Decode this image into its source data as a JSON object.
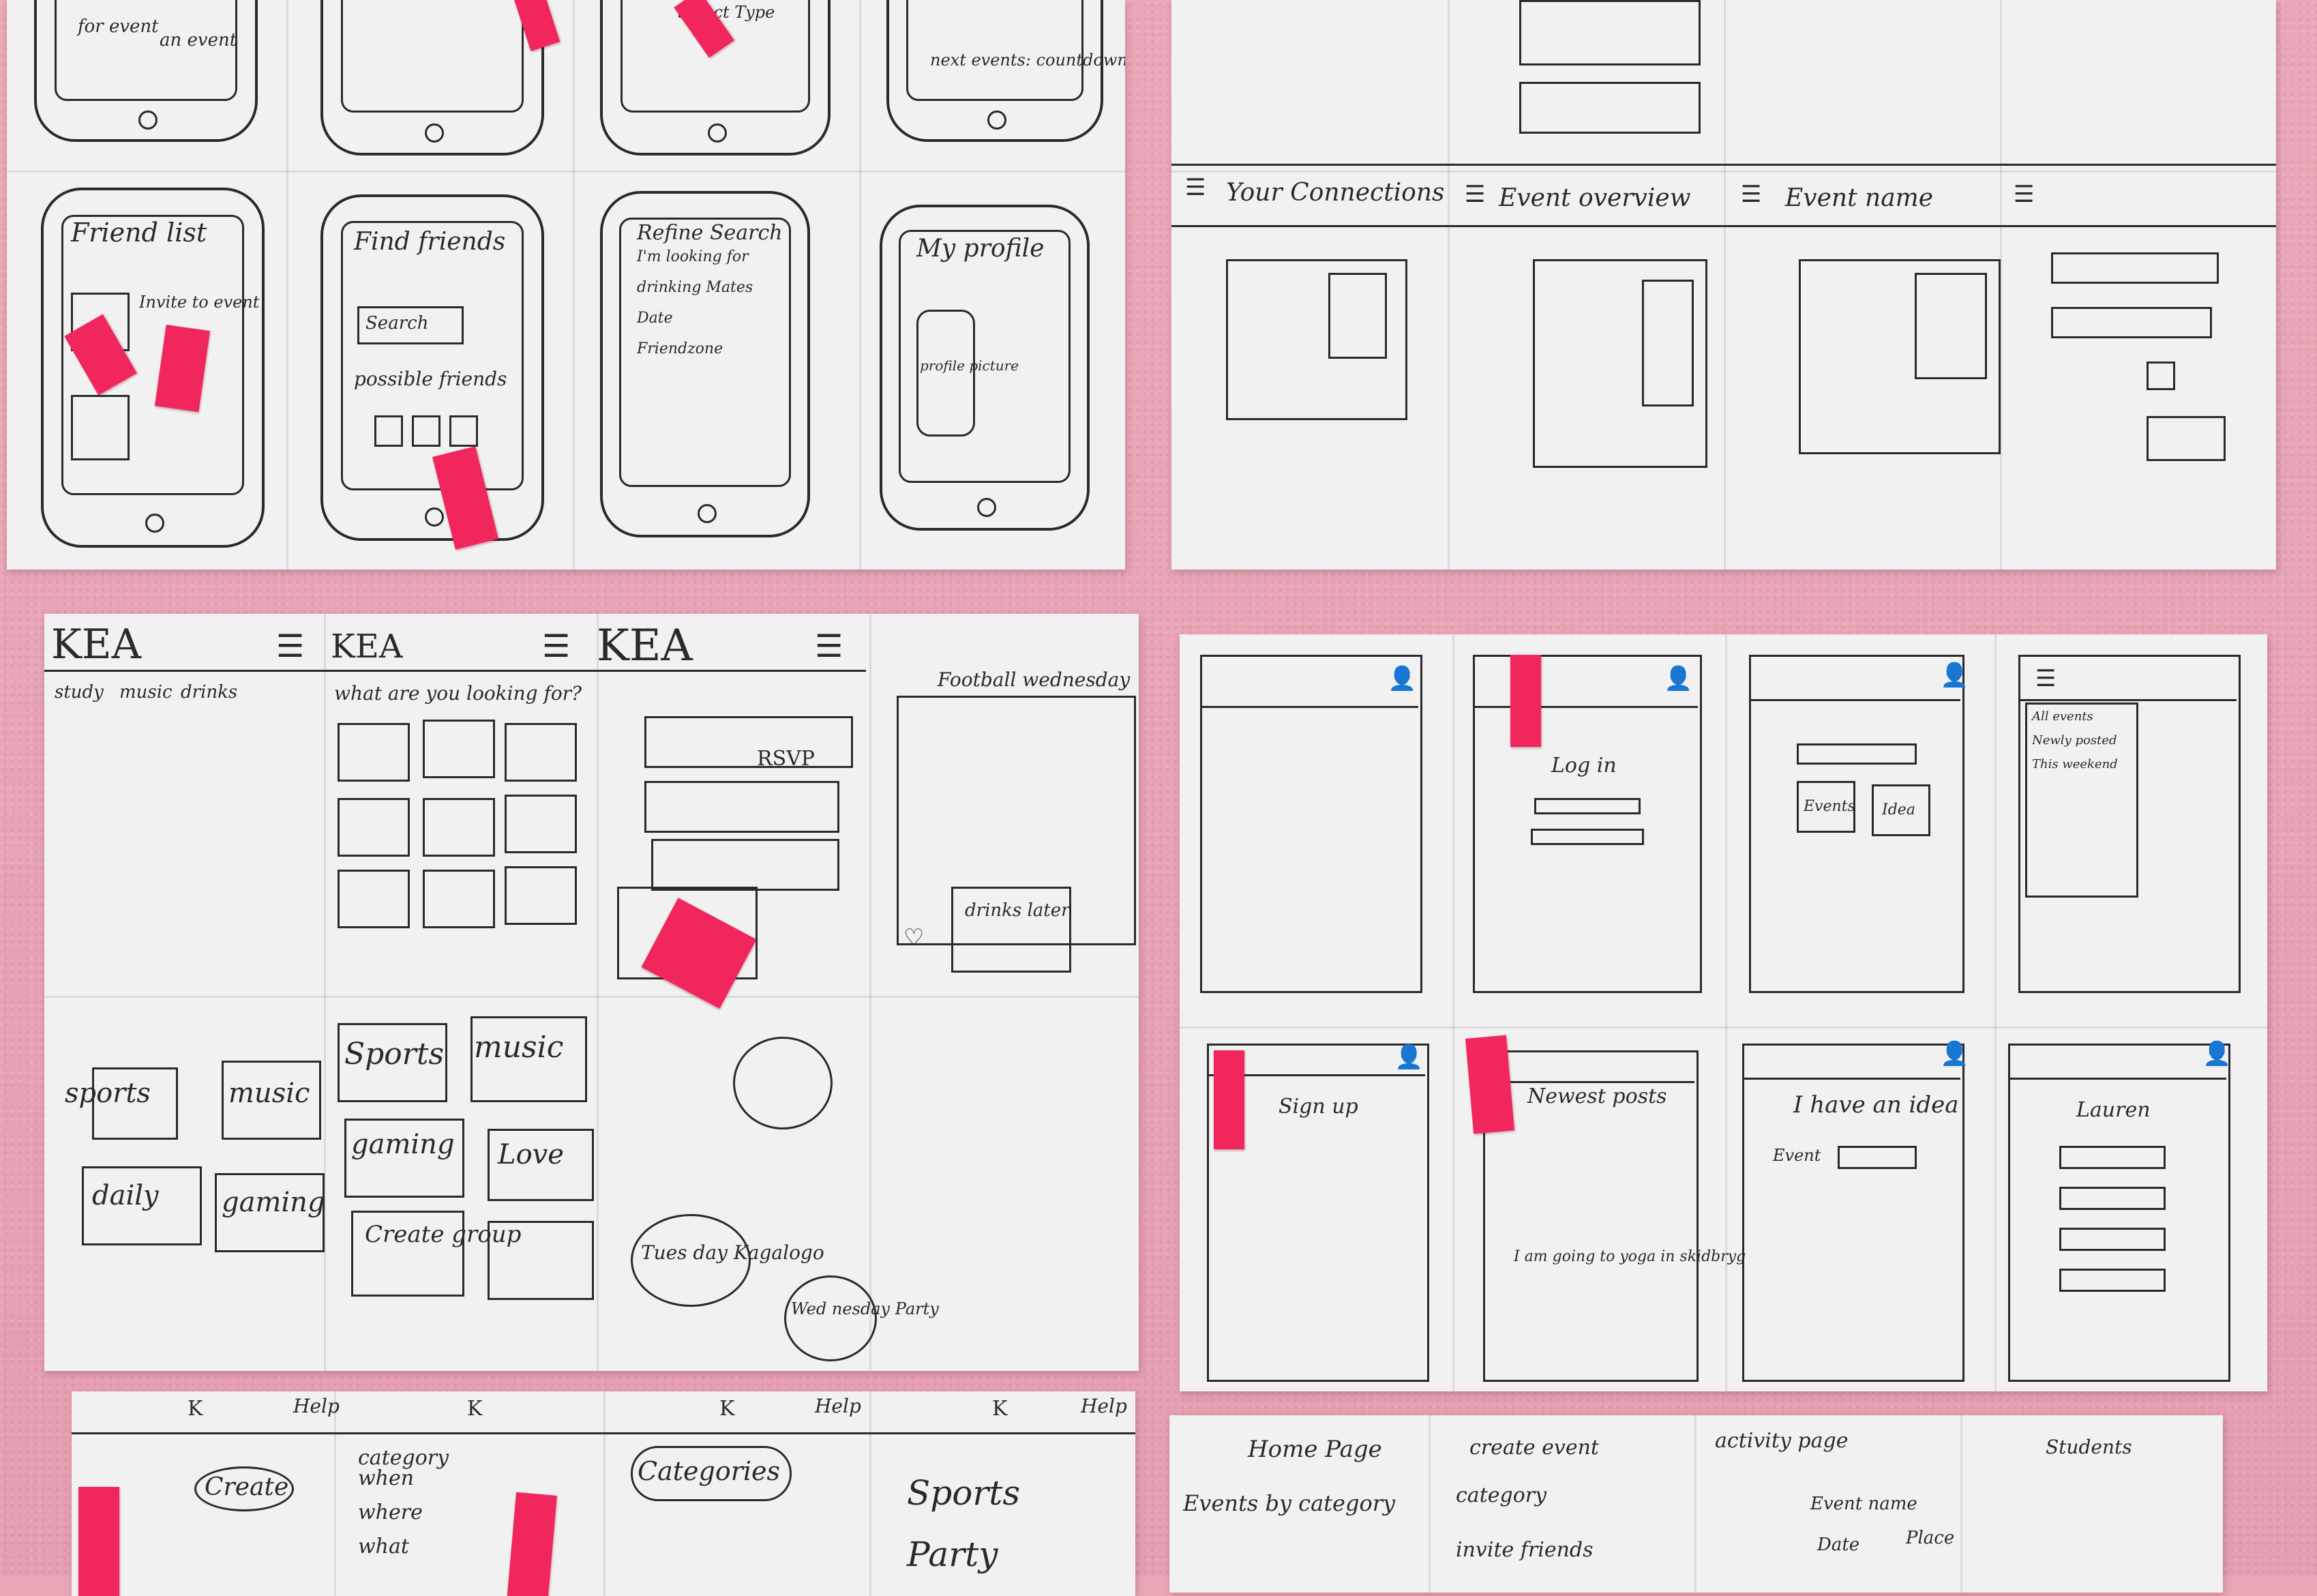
{
  "colors": {
    "wall": "#e9a7b6",
    "paper": "#f1f1f2",
    "ink": "#2a2a2e",
    "sticky_note": "#f0265c"
  },
  "sheet_a": {
    "top_row": [
      "for event",
      "an event",
      "Select Type",
      "next events: countdown"
    ],
    "friend_list": {
      "title": "Friend list",
      "action": "Invite to event"
    },
    "find_friends": {
      "title": "Find friends",
      "button": "Search",
      "caption": "possible friends"
    },
    "refine_search": {
      "title": "Refine Search",
      "lines": [
        "I'm looking for",
        "drinking Mates",
        "Date",
        "Friendzone"
      ]
    },
    "my_profile": {
      "title": "My profile",
      "picture": "profile picture"
    }
  },
  "sheet_b": {
    "cells": [
      "Your Connections",
      "Event overview",
      "Event name"
    ]
  },
  "sheet_c": {
    "logo": "KEA",
    "prompt": "what are you looking for?",
    "chips": [
      "study",
      "music",
      "drinks"
    ],
    "rsvp": "RSVP",
    "event": "Football wednesday",
    "drinks": "drinks later",
    "groups": [
      "sports",
      "music",
      "daily",
      "gaming"
    ],
    "groups2": [
      "Sports",
      "music",
      "gaming",
      "Love",
      "Create group"
    ],
    "bubbles": [
      "Tues day Kagalogo",
      "Wed nesday Party"
    ]
  },
  "sheet_d": {
    "login": "Log in",
    "signup": "Sign up",
    "newest_posts": "Newest posts",
    "idea": "I have an idea",
    "event_label": "Event",
    "events_btn": "Events",
    "ideas_btn": "Idea",
    "menu_items": [
      "All events",
      "Newly posted",
      "This weekend"
    ],
    "post_text": "I am going to yoga in skidbryg",
    "last_title": "Lauren"
  },
  "sheet_e": {
    "header_letter": "K",
    "help": "Help",
    "create": "Create",
    "fields": [
      "category",
      "when",
      "where",
      "what"
    ],
    "categories": "Categories",
    "list": [
      "Sports",
      "Party"
    ]
  },
  "sheet_f": {
    "notes": [
      "Home Page",
      "Events by category",
      "create event",
      "category",
      "invite friends",
      "activity page",
      "Students",
      "Event name",
      "Place",
      "Date"
    ]
  }
}
